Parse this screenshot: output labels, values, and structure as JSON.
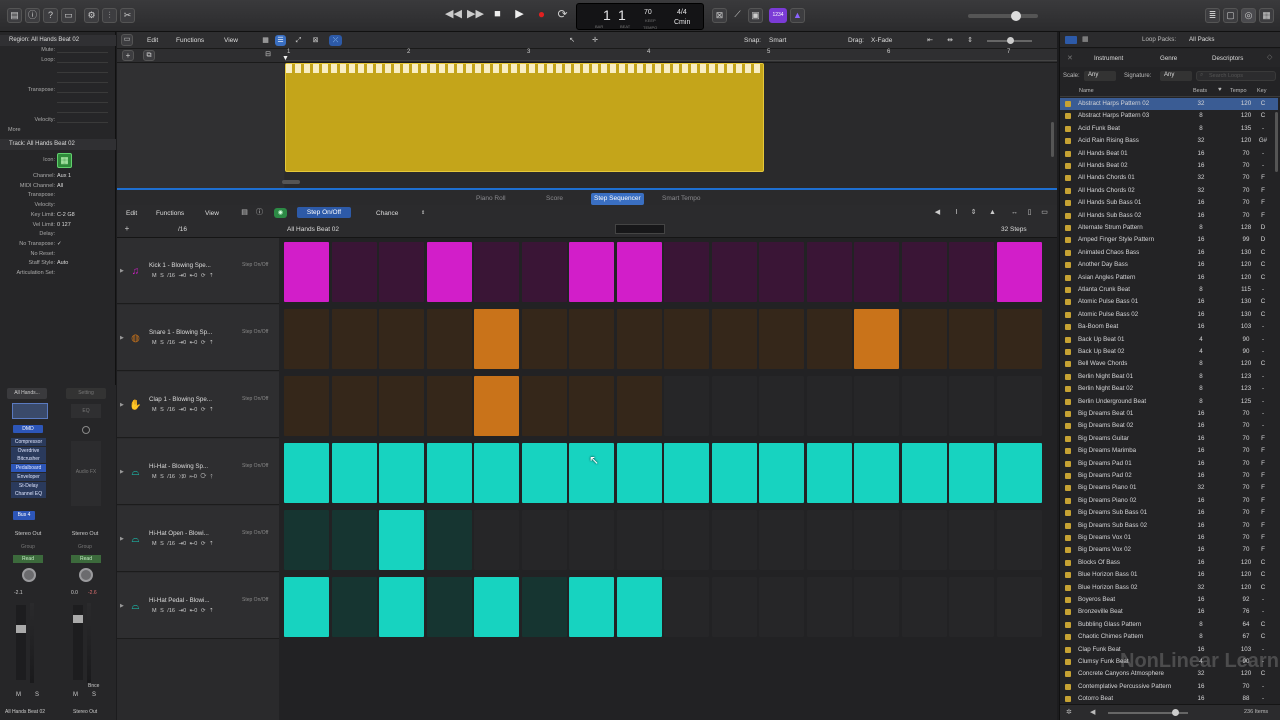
{
  "transport": {
    "bar": "1",
    "beat": "1",
    "bar_cap": "BAR",
    "beat_cap": "BEAT",
    "tempo": "70",
    "tempo_cap": "KEEP",
    "tempo_cap2": "TEMPO",
    "sig": "4/4",
    "key": "Cmin",
    "cycle_badge": "1234"
  },
  "region_inspector": {
    "title": "Region: All Hands Beat 02",
    "rows": [
      {
        "label": "Mute:",
        "value": ""
      },
      {
        "label": "Loop:",
        "value": ""
      },
      {
        "label": "",
        "value": ""
      },
      {
        "label": "",
        "value": ""
      },
      {
        "label": "Transpose:",
        "value": ""
      },
      {
        "label": "",
        "value": ""
      },
      {
        "label": "",
        "value": ""
      },
      {
        "label": "Velocity:",
        "value": ""
      }
    ],
    "more": "More"
  },
  "track_inspector": {
    "title": "Track: All Hands Beat 02",
    "icon_label": "Icon:",
    "rows": [
      {
        "label": "Channel:",
        "value": "Aux 1"
      },
      {
        "label": "MIDI Channel:",
        "value": "All"
      },
      {
        "label": "Transpose:",
        "value": ""
      },
      {
        "label": "Velocity:",
        "value": ""
      },
      {
        "label": "Key Limit:",
        "value": "C-2  G8"
      },
      {
        "label": "Vel Limit:",
        "value": "0  127"
      },
      {
        "label": "Delay:",
        "value": ""
      },
      {
        "label": "No Transpose:",
        "value": "✓"
      },
      {
        "label": "No Reset:",
        "value": ""
      },
      {
        "label": "Staff Style:",
        "value": "Auto"
      },
      {
        "label": "Articulation Set:",
        "value": ""
      }
    ]
  },
  "mixer": {
    "left": {
      "setting": "All Hands...",
      "dmd": "DMD",
      "plugins": [
        "Compressor",
        "Overdrive",
        "Bitcrusher",
        "Pedalboard",
        "Enveloper",
        "St-Delay",
        "Channel EQ"
      ],
      "send": "Bus 4",
      "output": "Stereo Out",
      "group": "Group",
      "read": "Read",
      "vol": "-2.1",
      "m": "M",
      "s": "S",
      "name": "All Hands Beat 02"
    },
    "right": {
      "setting": "Setting",
      "eq": "EQ",
      "audiofx": "Audio FX",
      "output": "Stereo Out",
      "group": "Group",
      "read": "Read",
      "vol1": "0.0",
      "vol2": "-2.6",
      "m": "M",
      "s": "S",
      "bnce": "Bnce",
      "name": "Stereo Out"
    }
  },
  "top_editor": {
    "menus": [
      "Edit",
      "Functions",
      "View"
    ],
    "snap_label": "Snap:",
    "snap_value": "Smart",
    "drag_label": "Drag:",
    "drag_value": "X-Fade",
    "ruler": [
      "1",
      "2",
      "3",
      "4",
      "5",
      "6",
      "7"
    ]
  },
  "tabs": [
    {
      "label": "Piano Roll",
      "active": false
    },
    {
      "label": "Score",
      "active": false
    },
    {
      "label": "Step Sequencer",
      "active": true
    },
    {
      "label": "Smart Tempo",
      "active": false
    }
  ],
  "sequencer": {
    "menus": [
      "Edit",
      "Functions",
      "View"
    ],
    "step_onoff": "Step On/Off",
    "chance": "Chance",
    "pattern_name": "All Hands Beat 02",
    "steps": "32 Steps",
    "rate": "/16",
    "rows": [
      {
        "name": "Kick 1 - Blowing Spe...",
        "tag": "Step On/Off",
        "ctrl": "M  S  /16  ⇥0  ⇤0  ⟳  ⇡",
        "color": "#d21ec9",
        "dim": "#3a1536",
        "icon": "kick-drum-icon",
        "glyph": "♫",
        "steps": [
          1,
          0,
          0,
          1,
          0,
          0,
          1,
          1,
          0,
          0,
          0,
          0,
          0,
          0,
          0,
          1
        ]
      },
      {
        "name": "Snare 1 - Blowing Sp...",
        "tag": "Step On/Off",
        "ctrl": "M  S  /16  ⇥0  ⇤0  ⟳  ⇡",
        "color": "#c9731a",
        "dim": "#35271a",
        "icon": "snare-drum-icon",
        "glyph": "◍",
        "steps": [
          0,
          0,
          0,
          0,
          1,
          0,
          0,
          0,
          0,
          0,
          0,
          0,
          1,
          0,
          0,
          0
        ]
      },
      {
        "name": "Clap 1 - Blowing Spe...",
        "tag": "Step On/Off",
        "ctrl": "M  S  /16  ⇥0  ⇤0  ⟳  ⇡",
        "color": "#c9731a",
        "dim": "#35271a",
        "icon": "clap-hand-icon",
        "glyph": "✋",
        "steps": [
          0,
          0,
          0,
          0,
          1,
          0,
          0,
          0
        ],
        "len": 8
      },
      {
        "name": "Hi-Hat - Blowing Sp...",
        "tag": "Step On/Off",
        "ctrl": "M  S  /16  ⤨0  ⇤0  ⟳  ⇡",
        "color": "#17d3c0",
        "dim": "#163531",
        "icon": "hi-hat-icon",
        "glyph": "⌓",
        "steps": [
          1,
          1,
          1,
          1,
          1,
          1,
          1,
          1,
          1,
          1,
          1,
          1,
          1,
          1,
          1,
          1
        ]
      },
      {
        "name": "Hi-Hat Open - Blowi...",
        "tag": "Step On/Off",
        "ctrl": "M  S  /16  ⇥0  ⇤0  ⟳  ⇡",
        "color": "#17d3c0",
        "dim": "#163531",
        "icon": "hi-hat-open-icon",
        "glyph": "⌓",
        "steps": [
          0,
          0,
          1,
          0
        ],
        "len": 4
      },
      {
        "name": "Hi-Hat Pedal - Blowi...",
        "tag": "Step On/Off",
        "ctrl": "M  S  /16  ⇥0  ⇤0  ⟳  ⇡",
        "color": "#17d3c0",
        "dim": "#163531",
        "icon": "hi-hat-pedal-icon",
        "glyph": "⌓",
        "steps": [
          1,
          0,
          1,
          0,
          1,
          0,
          1,
          1
        ],
        "len": 8
      }
    ]
  },
  "loop_browser": {
    "title": "Loop Packs:",
    "pack": "All Packs",
    "tabs": [
      "Instrument",
      "Genre",
      "Descriptors"
    ],
    "scale_label": "Scale:",
    "scale_value": "Any",
    "sig_label": "Signature:",
    "sig_value": "Any",
    "search_placeholder": "Search Loops",
    "cols": {
      "name": "Name",
      "beats": "Beats",
      "tempo": "Tempo",
      "key": "Key"
    },
    "items": [
      [
        "Abstract Harps Pattern 02",
        "32",
        "120",
        "C"
      ],
      [
        "Abstract Harps Pattern 03",
        "8",
        "120",
        "C"
      ],
      [
        "Acid Funk Beat",
        "8",
        "135",
        "-"
      ],
      [
        "Acid Rain Rising Bass",
        "32",
        "120",
        "G#"
      ],
      [
        "All Hands Beat 01",
        "16",
        "70",
        "-"
      ],
      [
        "All Hands Beat 02",
        "16",
        "70",
        "-"
      ],
      [
        "All Hands Chords 01",
        "32",
        "70",
        "F"
      ],
      [
        "All Hands Chords 02",
        "32",
        "70",
        "F"
      ],
      [
        "All Hands Sub Bass 01",
        "16",
        "70",
        "F"
      ],
      [
        "All Hands Sub Bass 02",
        "16",
        "70",
        "F"
      ],
      [
        "Alternate Strum Pattern",
        "8",
        "128",
        "D"
      ],
      [
        "Amped Finger Style Pattern",
        "16",
        "99",
        "D"
      ],
      [
        "Animated Chaos Bass",
        "16",
        "130",
        "C"
      ],
      [
        "Another Day Bass",
        "16",
        "120",
        "C"
      ],
      [
        "Asian Angles Pattern",
        "16",
        "120",
        "C"
      ],
      [
        "Atlanta Crunk Beat",
        "8",
        "115",
        "-"
      ],
      [
        "Atomic Pulse Bass 01",
        "16",
        "130",
        "C"
      ],
      [
        "Atomic Pulse Bass 02",
        "16",
        "130",
        "C"
      ],
      [
        "Ba-Boom Beat",
        "16",
        "103",
        "-"
      ],
      [
        "Back Up Beat 01",
        "4",
        "90",
        "-"
      ],
      [
        "Back Up Beat 02",
        "4",
        "90",
        "-"
      ],
      [
        "Bell Wave Chords",
        "8",
        "120",
        "C"
      ],
      [
        "Berlin Night Beat 01",
        "8",
        "123",
        "-"
      ],
      [
        "Berlin Night Beat 02",
        "8",
        "123",
        "-"
      ],
      [
        "Berlin Underground Beat",
        "8",
        "125",
        "-"
      ],
      [
        "Big Dreams Beat 01",
        "16",
        "70",
        "-"
      ],
      [
        "Big Dreams Beat 02",
        "16",
        "70",
        "-"
      ],
      [
        "Big Dreams Guitar",
        "16",
        "70",
        "F"
      ],
      [
        "Big Dreams Marimba",
        "16",
        "70",
        "F"
      ],
      [
        "Big Dreams Pad 01",
        "16",
        "70",
        "F"
      ],
      [
        "Big Dreams Pad 02",
        "16",
        "70",
        "F"
      ],
      [
        "Big Dreams Piano 01",
        "32",
        "70",
        "F"
      ],
      [
        "Big Dreams Piano 02",
        "16",
        "70",
        "F"
      ],
      [
        "Big Dreams Sub Bass 01",
        "16",
        "70",
        "F"
      ],
      [
        "Big Dreams Sub Bass 02",
        "16",
        "70",
        "F"
      ],
      [
        "Big Dreams Vox 01",
        "16",
        "70",
        "F"
      ],
      [
        "Big Dreams Vox 02",
        "16",
        "70",
        "F"
      ],
      [
        "Blocks Of Bass",
        "16",
        "120",
        "C"
      ],
      [
        "Blue Horizon Bass 01",
        "16",
        "120",
        "C"
      ],
      [
        "Blue Horizon Bass 02",
        "32",
        "120",
        "C"
      ],
      [
        "Boyeros Beat",
        "16",
        "92",
        "-"
      ],
      [
        "Bronzeville Beat",
        "16",
        "76",
        "-"
      ],
      [
        "Bubbling Glass Pattern",
        "8",
        "64",
        "C"
      ],
      [
        "Chaotic Chimes Pattern",
        "8",
        "67",
        "C"
      ],
      [
        "Clap Funk Beat",
        "16",
        "103",
        "-"
      ],
      [
        "Clumsy Funk Beat",
        "4",
        "90",
        "-"
      ],
      [
        "Concrete Canyons Atmosphere",
        "32",
        "120",
        "C"
      ],
      [
        "Contemplative Percussive Pattern",
        "16",
        "70",
        "-"
      ],
      [
        "Cotorro Beat",
        "16",
        "88",
        "-"
      ]
    ],
    "count": "236 Items"
  },
  "watermark": "NonLinear Learning Inc."
}
